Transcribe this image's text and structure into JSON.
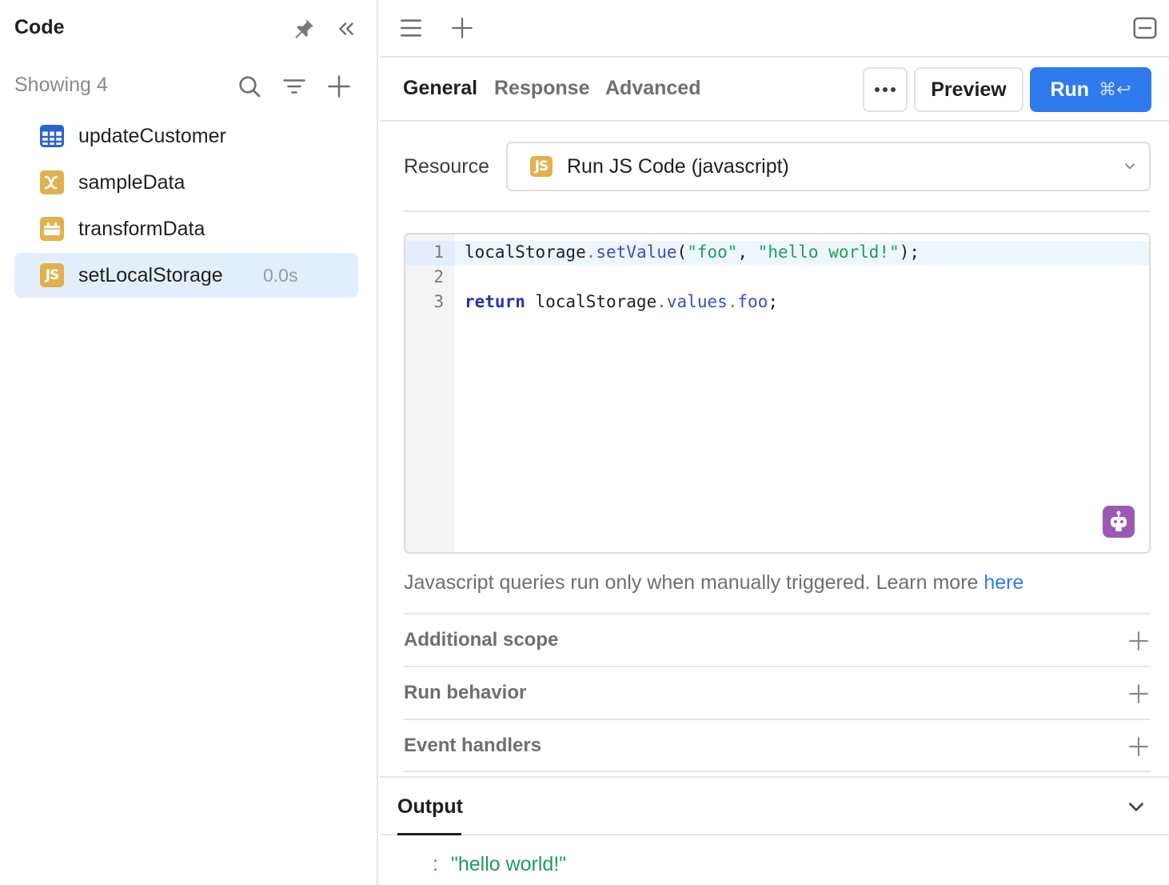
{
  "sidebar": {
    "title": "Code",
    "showing": "Showing 4",
    "items": [
      {
        "label": "updateCustomer",
        "icon": "table-icon",
        "time": ""
      },
      {
        "label": "sampleData",
        "icon": "variable-icon",
        "time": ""
      },
      {
        "label": "transformData",
        "icon": "transformer-icon",
        "time": ""
      },
      {
        "label": "setLocalStorage",
        "icon": "js-icon",
        "time": "0.0s",
        "selected": true
      }
    ]
  },
  "tabs": {
    "general": "General",
    "response": "Response",
    "advanced": "Advanced"
  },
  "toolbar": {
    "preview_label": "Preview",
    "run_label": "Run",
    "run_shortcut": "⌘↩"
  },
  "resource": {
    "label": "Resource",
    "value": "Run JS Code (javascript)",
    "badge": "JS"
  },
  "editor": {
    "line_numbers": [
      "1",
      "2",
      "3"
    ]
  },
  "note": {
    "text": "Javascript queries run only when manually triggered. Learn more ",
    "link": "here"
  },
  "sections": {
    "additional_scope": "Additional scope",
    "run_behavior": "Run behavior",
    "event_handlers": "Event handlers"
  },
  "output": {
    "title": "Output",
    "colon": ":",
    "value": "\"hello world!\""
  },
  "colors": {
    "accent": "#2f7bee",
    "selected_bg": "#e3eefd",
    "js_badge": "#e2b14f",
    "ai_button": "#9b59b6"
  }
}
